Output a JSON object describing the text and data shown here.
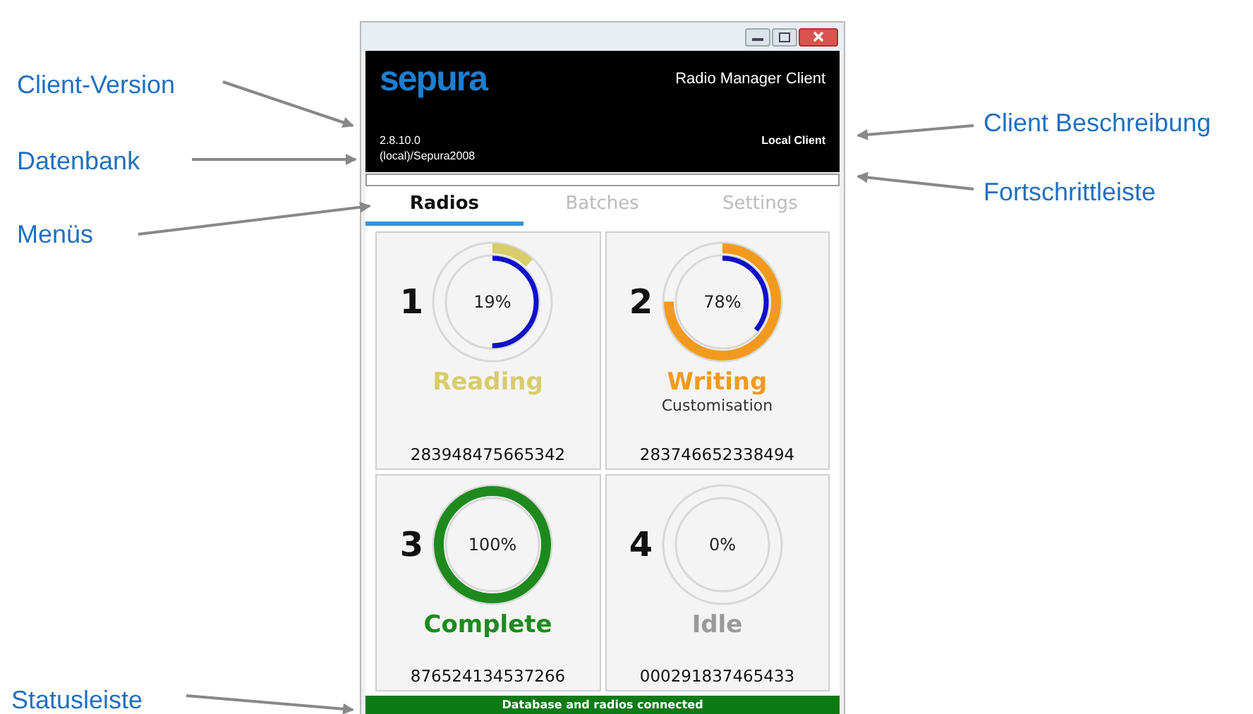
{
  "left_callouts": [
    "Client-Version",
    "Datenbank",
    "Menüs",
    "Statusleiste"
  ],
  "right_callouts": [
    "Client Beschreibung",
    "Fortschrittleiste"
  ],
  "window": {
    "logo": "sepura",
    "app_title": "Radio Manager Client",
    "version": "2.8.10.0",
    "database": "(local)/Sepura2008",
    "description": "Local Client"
  },
  "tabs": [
    {
      "label": "Radios",
      "selected": true
    },
    {
      "label": "Batches",
      "selected": false
    },
    {
      "label": "Settings",
      "selected": false
    }
  ],
  "radios": [
    {
      "number": "1",
      "percent": "19%",
      "status": "Reading",
      "color": "#d9cc6a",
      "outer_ring": {
        "level": 0.12
      },
      "inner_ring": {
        "level": 0.5
      },
      "serial": "283948475665342"
    },
    {
      "number": "2",
      "percent": "78%",
      "status": "Writing",
      "color": "#f39a1e",
      "outer_ring": {
        "level": 0.75
      },
      "inner_ring": {
        "level": 0.36
      },
      "detail": "Customisation",
      "serial": "283746652338494"
    },
    {
      "number": "3",
      "percent": "100%",
      "status": "Complete",
      "color": "#1e8a1e",
      "outer_ring": {
        "level": 1
      },
      "serial": "876524134537266"
    },
    {
      "number": "4",
      "percent": "0%",
      "status": "Idle",
      "color": "#9a9a9a",
      "serial": "000291837465433"
    }
  ],
  "status_bar": "Database and radios connected"
}
